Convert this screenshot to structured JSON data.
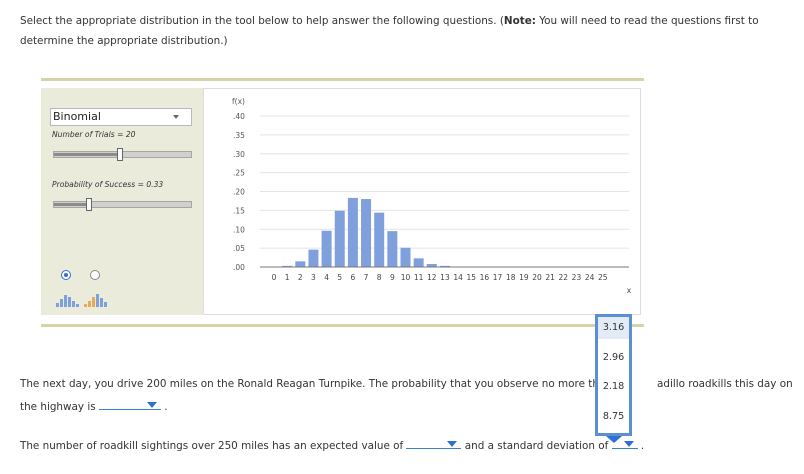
{
  "instructions": {
    "text_pre": "Select the appropriate distribution in the tool below to help answer the following questions. (",
    "note_label": "Note:",
    "text_post": " You will need to read the questions first to determine the appropriate distribution.)"
  },
  "tool": {
    "distribution_select": "Binomial",
    "trials_label": "Number of Trials = 20",
    "trials_value": 20,
    "trials_max": 40,
    "success_label": "Probability of Success = 0.33",
    "success_value": 0.33,
    "chart_mode": "pmf"
  },
  "chart_data": {
    "type": "bar",
    "ylabel": "f(x)",
    "xlabel": "x",
    "ylim": [
      0,
      0.4
    ],
    "yticks": [
      ".40",
      ".35",
      ".30",
      ".25",
      ".20",
      ".15",
      ".10",
      ".05",
      ".00"
    ],
    "ytick_values": [
      0.4,
      0.35,
      0.3,
      0.25,
      0.2,
      0.15,
      0.1,
      0.05,
      0.0
    ],
    "categories": [
      "0",
      "1",
      "2",
      "3",
      "4",
      "5",
      "6",
      "7",
      "8",
      "9",
      "10",
      "11",
      "12",
      "13",
      "14",
      "15",
      "16",
      "17",
      "18",
      "19",
      "20",
      "21",
      "22",
      "23",
      "24",
      "25"
    ],
    "values": [
      0.0003,
      0.003,
      0.015,
      0.046,
      0.096,
      0.149,
      0.183,
      0.18,
      0.144,
      0.095,
      0.051,
      0.023,
      0.008,
      0.003,
      0.001,
      0,
      0,
      0,
      0,
      0,
      0,
      0,
      0,
      0,
      0,
      0
    ],
    "grid": true,
    "bar_color": "#7fa0dd"
  },
  "question1": {
    "text_a": "The next day, you drive 200 miles on the Ronald Reagan Turnpike. The probability that you observe no more than ",
    "text_b": "adillo roadkills this day on",
    "text_c": "the highway is ",
    "text_d": " ."
  },
  "question2": {
    "text_a": "The number of roadkill sightings over 250 miles has an expected value of ",
    "text_b": " and a standard deviation of ",
    "text_c": " ."
  },
  "dropdown_menu": {
    "options": [
      "3.16",
      "2.96",
      "2.18",
      "8.75"
    ],
    "highlighted": "3.16"
  }
}
